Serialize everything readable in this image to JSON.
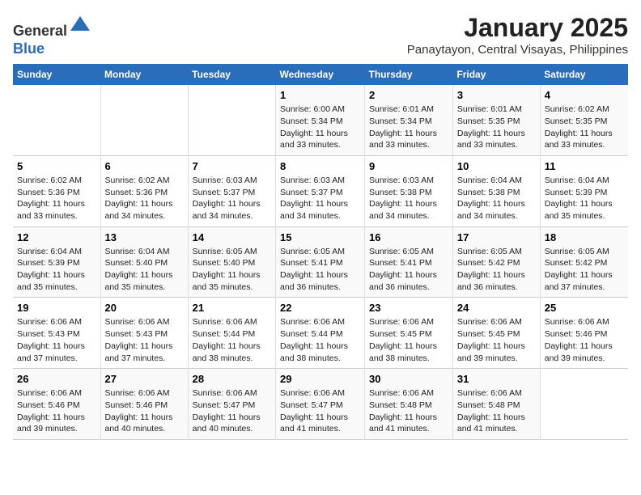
{
  "header": {
    "logo_line1": "General",
    "logo_line2": "Blue",
    "month": "January 2025",
    "location": "Panaytayon, Central Visayas, Philippines"
  },
  "weekdays": [
    "Sunday",
    "Monday",
    "Tuesday",
    "Wednesday",
    "Thursday",
    "Friday",
    "Saturday"
  ],
  "weeks": [
    [
      {
        "day": "",
        "content": ""
      },
      {
        "day": "",
        "content": ""
      },
      {
        "day": "",
        "content": ""
      },
      {
        "day": "1",
        "content": "Sunrise: 6:00 AM\nSunset: 5:34 PM\nDaylight: 11 hours and 33 minutes."
      },
      {
        "day": "2",
        "content": "Sunrise: 6:01 AM\nSunset: 5:34 PM\nDaylight: 11 hours and 33 minutes."
      },
      {
        "day": "3",
        "content": "Sunrise: 6:01 AM\nSunset: 5:35 PM\nDaylight: 11 hours and 33 minutes."
      },
      {
        "day": "4",
        "content": "Sunrise: 6:02 AM\nSunset: 5:35 PM\nDaylight: 11 hours and 33 minutes."
      }
    ],
    [
      {
        "day": "5",
        "content": "Sunrise: 6:02 AM\nSunset: 5:36 PM\nDaylight: 11 hours and 33 minutes."
      },
      {
        "day": "6",
        "content": "Sunrise: 6:02 AM\nSunset: 5:36 PM\nDaylight: 11 hours and 34 minutes."
      },
      {
        "day": "7",
        "content": "Sunrise: 6:03 AM\nSunset: 5:37 PM\nDaylight: 11 hours and 34 minutes."
      },
      {
        "day": "8",
        "content": "Sunrise: 6:03 AM\nSunset: 5:37 PM\nDaylight: 11 hours and 34 minutes."
      },
      {
        "day": "9",
        "content": "Sunrise: 6:03 AM\nSunset: 5:38 PM\nDaylight: 11 hours and 34 minutes."
      },
      {
        "day": "10",
        "content": "Sunrise: 6:04 AM\nSunset: 5:38 PM\nDaylight: 11 hours and 34 minutes."
      },
      {
        "day": "11",
        "content": "Sunrise: 6:04 AM\nSunset: 5:39 PM\nDaylight: 11 hours and 35 minutes."
      }
    ],
    [
      {
        "day": "12",
        "content": "Sunrise: 6:04 AM\nSunset: 5:39 PM\nDaylight: 11 hours and 35 minutes."
      },
      {
        "day": "13",
        "content": "Sunrise: 6:04 AM\nSunset: 5:40 PM\nDaylight: 11 hours and 35 minutes."
      },
      {
        "day": "14",
        "content": "Sunrise: 6:05 AM\nSunset: 5:40 PM\nDaylight: 11 hours and 35 minutes."
      },
      {
        "day": "15",
        "content": "Sunrise: 6:05 AM\nSunset: 5:41 PM\nDaylight: 11 hours and 36 minutes."
      },
      {
        "day": "16",
        "content": "Sunrise: 6:05 AM\nSunset: 5:41 PM\nDaylight: 11 hours and 36 minutes."
      },
      {
        "day": "17",
        "content": "Sunrise: 6:05 AM\nSunset: 5:42 PM\nDaylight: 11 hours and 36 minutes."
      },
      {
        "day": "18",
        "content": "Sunrise: 6:05 AM\nSunset: 5:42 PM\nDaylight: 11 hours and 37 minutes."
      }
    ],
    [
      {
        "day": "19",
        "content": "Sunrise: 6:06 AM\nSunset: 5:43 PM\nDaylight: 11 hours and 37 minutes."
      },
      {
        "day": "20",
        "content": "Sunrise: 6:06 AM\nSunset: 5:43 PM\nDaylight: 11 hours and 37 minutes."
      },
      {
        "day": "21",
        "content": "Sunrise: 6:06 AM\nSunset: 5:44 PM\nDaylight: 11 hours and 38 minutes."
      },
      {
        "day": "22",
        "content": "Sunrise: 6:06 AM\nSunset: 5:44 PM\nDaylight: 11 hours and 38 minutes."
      },
      {
        "day": "23",
        "content": "Sunrise: 6:06 AM\nSunset: 5:45 PM\nDaylight: 11 hours and 38 minutes."
      },
      {
        "day": "24",
        "content": "Sunrise: 6:06 AM\nSunset: 5:45 PM\nDaylight: 11 hours and 39 minutes."
      },
      {
        "day": "25",
        "content": "Sunrise: 6:06 AM\nSunset: 5:46 PM\nDaylight: 11 hours and 39 minutes."
      }
    ],
    [
      {
        "day": "26",
        "content": "Sunrise: 6:06 AM\nSunset: 5:46 PM\nDaylight: 11 hours and 39 minutes."
      },
      {
        "day": "27",
        "content": "Sunrise: 6:06 AM\nSunset: 5:46 PM\nDaylight: 11 hours and 40 minutes."
      },
      {
        "day": "28",
        "content": "Sunrise: 6:06 AM\nSunset: 5:47 PM\nDaylight: 11 hours and 40 minutes."
      },
      {
        "day": "29",
        "content": "Sunrise: 6:06 AM\nSunset: 5:47 PM\nDaylight: 11 hours and 41 minutes."
      },
      {
        "day": "30",
        "content": "Sunrise: 6:06 AM\nSunset: 5:48 PM\nDaylight: 11 hours and 41 minutes."
      },
      {
        "day": "31",
        "content": "Sunrise: 6:06 AM\nSunset: 5:48 PM\nDaylight: 11 hours and 41 minutes."
      },
      {
        "day": "",
        "content": ""
      }
    ]
  ]
}
